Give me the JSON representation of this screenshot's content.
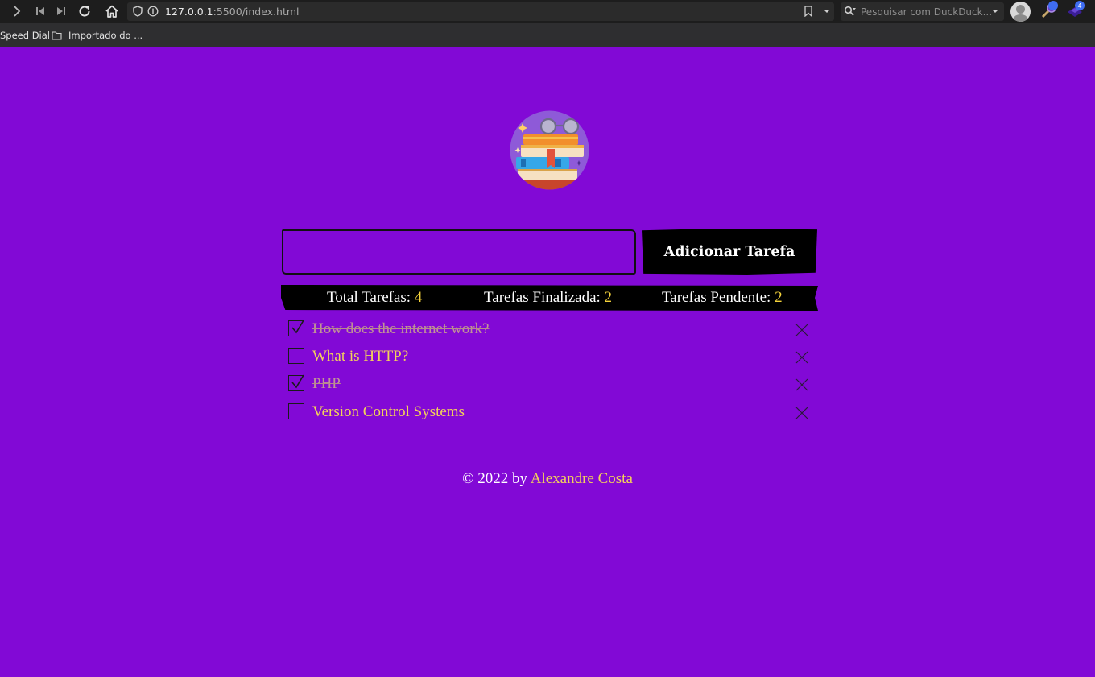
{
  "browser": {
    "url_host": "127.0.0.1",
    "url_rest": ":5500/index.html",
    "search_placeholder": "Pesquisar com DuckDuck...",
    "bookmarks": [
      "Speed Dial",
      "Importado do ..."
    ],
    "extension_badges": [
      "4"
    ]
  },
  "form": {
    "input_value": "",
    "add_button_label": "Adicionar Tarefa"
  },
  "stats": {
    "total_label": "Total Tarefas:",
    "total_value": "4",
    "done_label": "Tarefas Finalizada:",
    "done_value": "2",
    "pending_label": "Tarefas Pendente:",
    "pending_value": "2"
  },
  "tasks": [
    {
      "text": "How does the internet work?",
      "done": true
    },
    {
      "text": "What is HTTP?",
      "done": false
    },
    {
      "text": "PHP",
      "done": true
    },
    {
      "text": "Version Control Systems",
      "done": false
    }
  ],
  "footer": {
    "prefix": "© 2022 by",
    "author": "Alexandre Costa"
  },
  "colors": {
    "background": "#8209d6",
    "accent": "#f3d25a",
    "panel": "#000000"
  }
}
